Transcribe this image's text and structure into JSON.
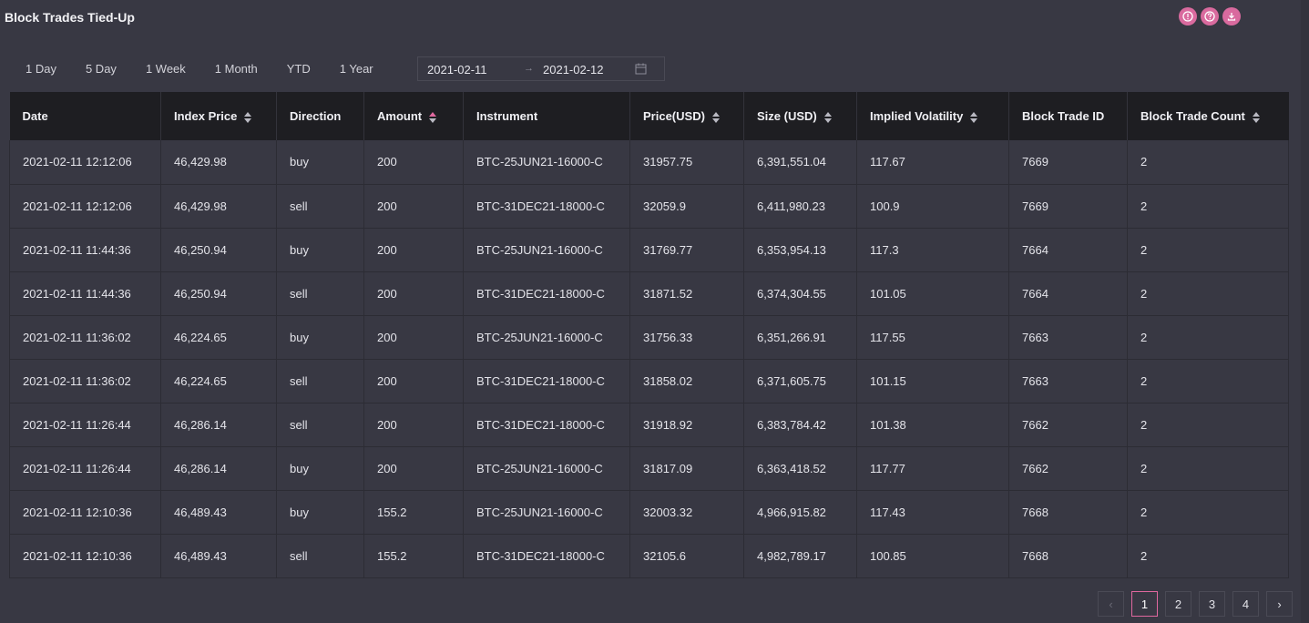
{
  "title": "Block Trades Tied-Up",
  "icons": [
    "info-icon",
    "help-icon",
    "download-icon"
  ],
  "range_buttons": [
    "1 Day",
    "5 Day",
    "1 Week",
    "1 Month",
    "YTD",
    "1 Year"
  ],
  "date_range": {
    "start": "2021-02-11",
    "separator": "→",
    "end": "2021-02-12"
  },
  "columns": [
    {
      "label": "Date",
      "sortable": false
    },
    {
      "label": "Index Price",
      "sortable": true
    },
    {
      "label": "Direction",
      "sortable": false
    },
    {
      "label": "Amount",
      "sortable": true,
      "active": "asc"
    },
    {
      "label": "Instrument",
      "sortable": false
    },
    {
      "label": "Price(USD)",
      "sortable": true
    },
    {
      "label": "Size (USD)",
      "sortable": true
    },
    {
      "label": "Implied Volatility",
      "sortable": true
    },
    {
      "label": "Block Trade ID",
      "sortable": false
    },
    {
      "label": "Block Trade Count",
      "sortable": true
    }
  ],
  "rows": [
    [
      "2021-02-11 12:12:06",
      "46,429.98",
      "buy",
      "200",
      "BTC-25JUN21-16000-C",
      "31957.75",
      "6,391,551.04",
      "117.67",
      "7669",
      "2"
    ],
    [
      "2021-02-11 12:12:06",
      "46,429.98",
      "sell",
      "200",
      "BTC-31DEC21-18000-C",
      "32059.9",
      "6,411,980.23",
      "100.9",
      "7669",
      "2"
    ],
    [
      "2021-02-11 11:44:36",
      "46,250.94",
      "buy",
      "200",
      "BTC-25JUN21-16000-C",
      "31769.77",
      "6,353,954.13",
      "117.3",
      "7664",
      "2"
    ],
    [
      "2021-02-11 11:44:36",
      "46,250.94",
      "sell",
      "200",
      "BTC-31DEC21-18000-C",
      "31871.52",
      "6,374,304.55",
      "101.05",
      "7664",
      "2"
    ],
    [
      "2021-02-11 11:36:02",
      "46,224.65",
      "buy",
      "200",
      "BTC-25JUN21-16000-C",
      "31756.33",
      "6,351,266.91",
      "117.55",
      "7663",
      "2"
    ],
    [
      "2021-02-11 11:36:02",
      "46,224.65",
      "sell",
      "200",
      "BTC-31DEC21-18000-C",
      "31858.02",
      "6,371,605.75",
      "101.15",
      "7663",
      "2"
    ],
    [
      "2021-02-11 11:26:44",
      "46,286.14",
      "sell",
      "200",
      "BTC-31DEC21-18000-C",
      "31918.92",
      "6,383,784.42",
      "101.38",
      "7662",
      "2"
    ],
    [
      "2021-02-11 11:26:44",
      "46,286.14",
      "buy",
      "200",
      "BTC-25JUN21-16000-C",
      "31817.09",
      "6,363,418.52",
      "117.77",
      "7662",
      "2"
    ],
    [
      "2021-02-11 12:10:36",
      "46,489.43",
      "buy",
      "155.2",
      "BTC-25JUN21-16000-C",
      "32003.32",
      "4,966,915.82",
      "117.43",
      "7668",
      "2"
    ],
    [
      "2021-02-11 12:10:36",
      "46,489.43",
      "sell",
      "155.2",
      "BTC-31DEC21-18000-C",
      "32105.6",
      "4,982,789.17",
      "100.85",
      "7668",
      "2"
    ]
  ],
  "pagination": {
    "prev": "‹",
    "pages": [
      "1",
      "2",
      "3",
      "4"
    ],
    "current": "1",
    "next": "›"
  },
  "colors": {
    "accent": "#e0689f",
    "background": "#383843",
    "header": "#1e1e22"
  }
}
